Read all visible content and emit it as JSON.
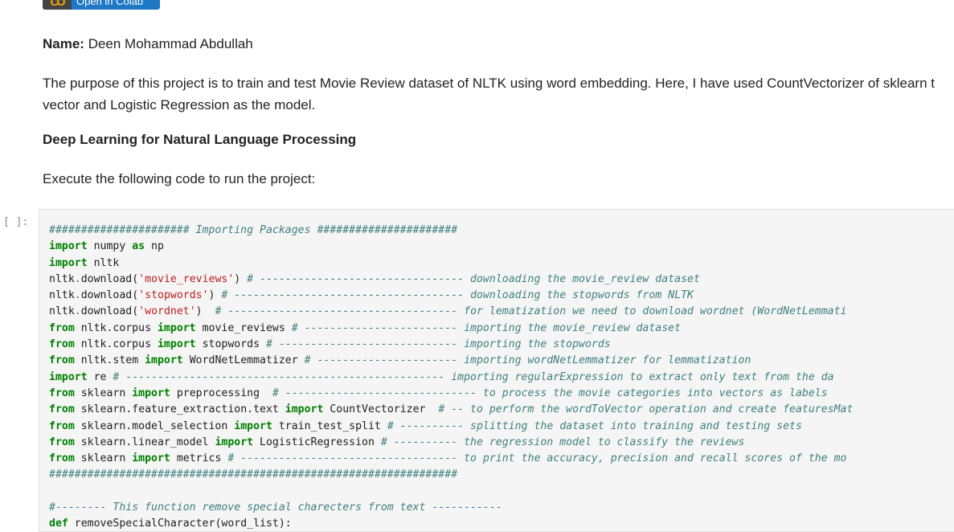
{
  "badge": {
    "label": "Open in Colab",
    "logo": "CO"
  },
  "markdown": {
    "name_label": "Name:",
    "name_value": " Deen Mohammad Abdullah",
    "purpose_line1": "The purpose of this project is to train and test Movie Review dataset of NLTK using word embedding. Here, I have used CountVectorizer of sklearn t",
    "purpose_line2": "vector and Logistic Regression as the model.",
    "heading": "Deep Learning for Natural Language Processing",
    "execute": "Execute the following code to run the project:"
  },
  "cell": {
    "prompt": "[ ]:",
    "lines": [
      [
        [
          "c",
          "###################### Importing Packages ######################"
        ]
      ],
      [
        [
          "k",
          "import"
        ],
        [
          "t",
          " numpy "
        ],
        [
          "k",
          "as"
        ],
        [
          "t",
          " np"
        ]
      ],
      [
        [
          "k",
          "import"
        ],
        [
          "t",
          " nltk"
        ]
      ],
      [
        [
          "t",
          "nltk"
        ],
        [
          "o",
          "."
        ],
        [
          "t",
          "download("
        ],
        [
          "s",
          "'movie_reviews'"
        ],
        [
          "t",
          ") "
        ],
        [
          "c",
          "# -------------------------------- downloading the movie_review dataset"
        ]
      ],
      [
        [
          "t",
          "nltk"
        ],
        [
          "o",
          "."
        ],
        [
          "t",
          "download("
        ],
        [
          "s",
          "'stopwords'"
        ],
        [
          "t",
          ") "
        ],
        [
          "c",
          "# ------------------------------------ downloading the stopwords from NLTK"
        ]
      ],
      [
        [
          "t",
          "nltk"
        ],
        [
          "o",
          "."
        ],
        [
          "t",
          "download("
        ],
        [
          "s",
          "'wordnet'"
        ],
        [
          "t",
          ")  "
        ],
        [
          "c",
          "# ------------------------------------ for lematization we need to download wordnet (WordNetLemmati"
        ]
      ],
      [
        [
          "k",
          "from"
        ],
        [
          "t",
          " nltk.corpus "
        ],
        [
          "k",
          "import"
        ],
        [
          "t",
          " movie_reviews "
        ],
        [
          "c",
          "# ------------------------ importing the movie_review dataset"
        ]
      ],
      [
        [
          "k",
          "from"
        ],
        [
          "t",
          " nltk.corpus "
        ],
        [
          "k",
          "import"
        ],
        [
          "t",
          " stopwords "
        ],
        [
          "c",
          "# ---------------------------- importing the stopwords"
        ]
      ],
      [
        [
          "k",
          "from"
        ],
        [
          "t",
          " nltk.stem "
        ],
        [
          "k",
          "import"
        ],
        [
          "t",
          " WordNetLemmatizer "
        ],
        [
          "c",
          "# ---------------------- importing wordNetLemmatizer for lemmatization"
        ]
      ],
      [
        [
          "k",
          "import"
        ],
        [
          "t",
          " re "
        ],
        [
          "c",
          "# -------------------------------------------------- importing regularExpression to extract only text from the da"
        ]
      ],
      [
        [
          "k",
          "from"
        ],
        [
          "t",
          " sklearn "
        ],
        [
          "k",
          "import"
        ],
        [
          "t",
          " preprocessing  "
        ],
        [
          "c",
          "# ------------------------------ to process the movie categories into vectors as labels"
        ]
      ],
      [
        [
          "k",
          "from"
        ],
        [
          "t",
          " sklearn.feature_extraction.text "
        ],
        [
          "k",
          "import"
        ],
        [
          "t",
          " CountVectorizer  "
        ],
        [
          "c",
          "# -- to perform the wordToVector operation and create featuresMat"
        ]
      ],
      [
        [
          "k",
          "from"
        ],
        [
          "t",
          " sklearn.model_selection "
        ],
        [
          "k",
          "import"
        ],
        [
          "t",
          " train_test_split "
        ],
        [
          "c",
          "# ---------- splitting the dataset into training and testing sets"
        ]
      ],
      [
        [
          "k",
          "from"
        ],
        [
          "t",
          " sklearn.linear_model "
        ],
        [
          "k",
          "import"
        ],
        [
          "t",
          " LogisticRegression "
        ],
        [
          "c",
          "# ---------- the regression model to classify the reviews"
        ]
      ],
      [
        [
          "k",
          "from"
        ],
        [
          "t",
          " sklearn "
        ],
        [
          "k",
          "import"
        ],
        [
          "t",
          " metrics "
        ],
        [
          "c",
          "# ---------------------------------- to print the accuracy, precision and recall scores of the mo"
        ]
      ],
      [
        [
          "c",
          "################################################################"
        ]
      ],
      [
        [
          "t",
          ""
        ]
      ],
      [
        [
          "c",
          "#-------- This function remove special charecters from text -----------"
        ]
      ],
      [
        [
          "k",
          "def"
        ],
        [
          "t",
          " removeSpecialCharacter(word_list):"
        ]
      ]
    ]
  }
}
